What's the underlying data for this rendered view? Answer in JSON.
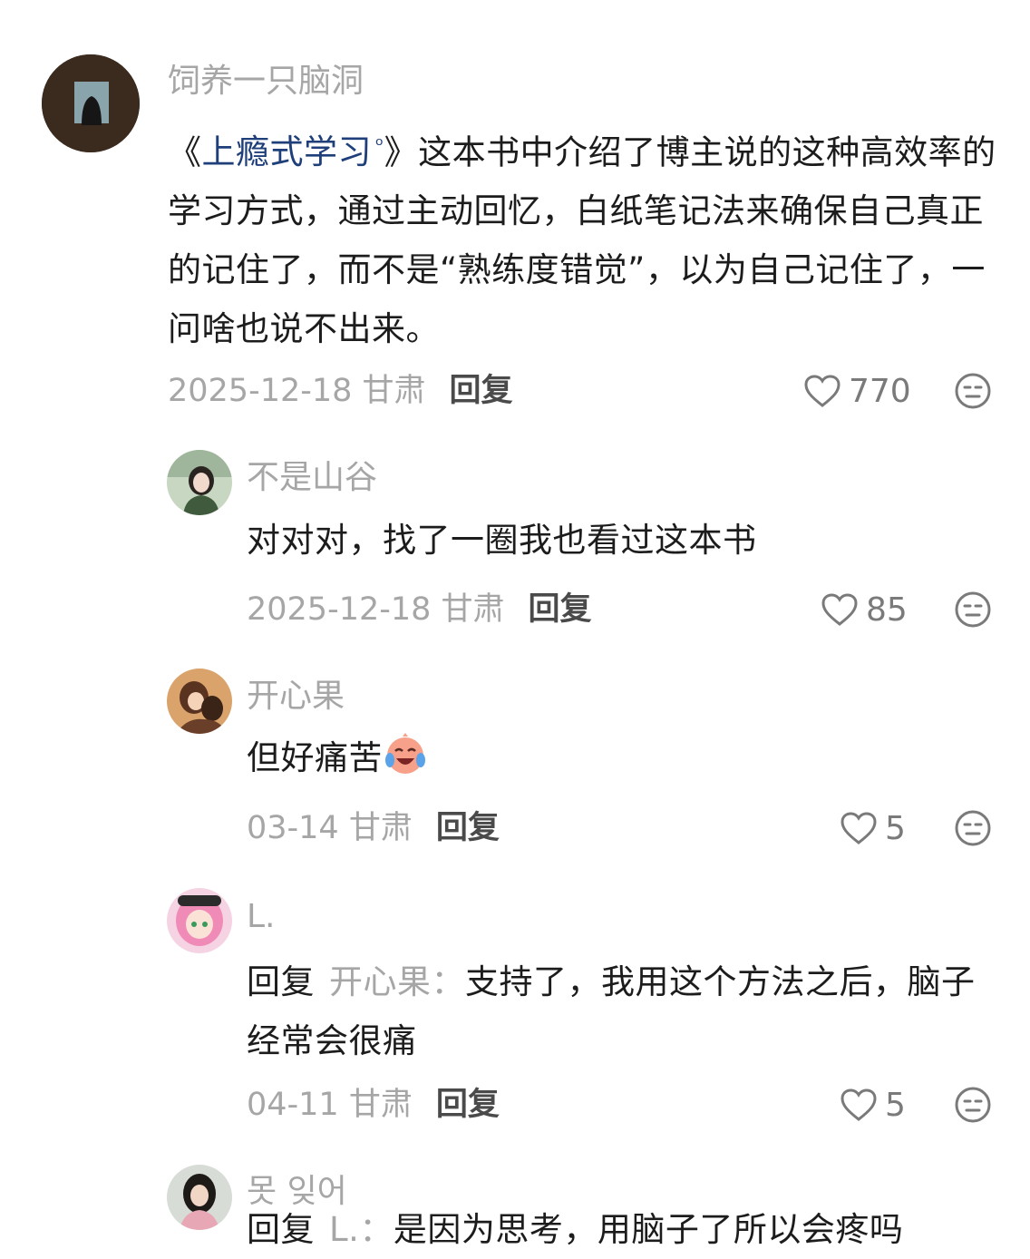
{
  "comments": [
    {
      "username": "饲养一只脑洞",
      "content_pre": "《",
      "book_link": "上瘾式学习",
      "content_post": "》这本书中介绍了博主说的这种高效率的学习方式，通过主动回忆，白纸笔记法来确保自己真正的记住了，而不是“熟练度错觉”，以为自己记住了，一问啥也说不出来。",
      "date": "2025-12-18 甘肃",
      "reply_label": "回复",
      "likes": "770"
    },
    {
      "username": "不是山谷",
      "content": "对对对，找了一圈我也看过这本书",
      "date": "2025-12-18 甘肃",
      "reply_label": "回复",
      "likes": "85"
    },
    {
      "username": "开心果",
      "content": "但好痛苦",
      "emoji": "crying-laughing-face",
      "date": "03-14 甘肃",
      "reply_label": "回复",
      "likes": "5"
    },
    {
      "username": "L.",
      "reply_prefix": "回复",
      "reply_target": "开心果：",
      "content": "支持了，我用这个方法之后，脑子经常会很痛",
      "date": "04-11 甘肃",
      "reply_label": "回复",
      "likes": "5"
    },
    {
      "username": "못 잊어",
      "reply_prefix": "回复",
      "reply_target": "L.：",
      "content": "是因为思考，用脑子了所以会疼吗"
    }
  ],
  "icons": {
    "like": "heart-outline-icon",
    "reaction": "neutral-face-icon"
  },
  "colors": {
    "link": "#1f3f7a",
    "muted": "#a6a6a6",
    "text": "#1c1c1c"
  }
}
